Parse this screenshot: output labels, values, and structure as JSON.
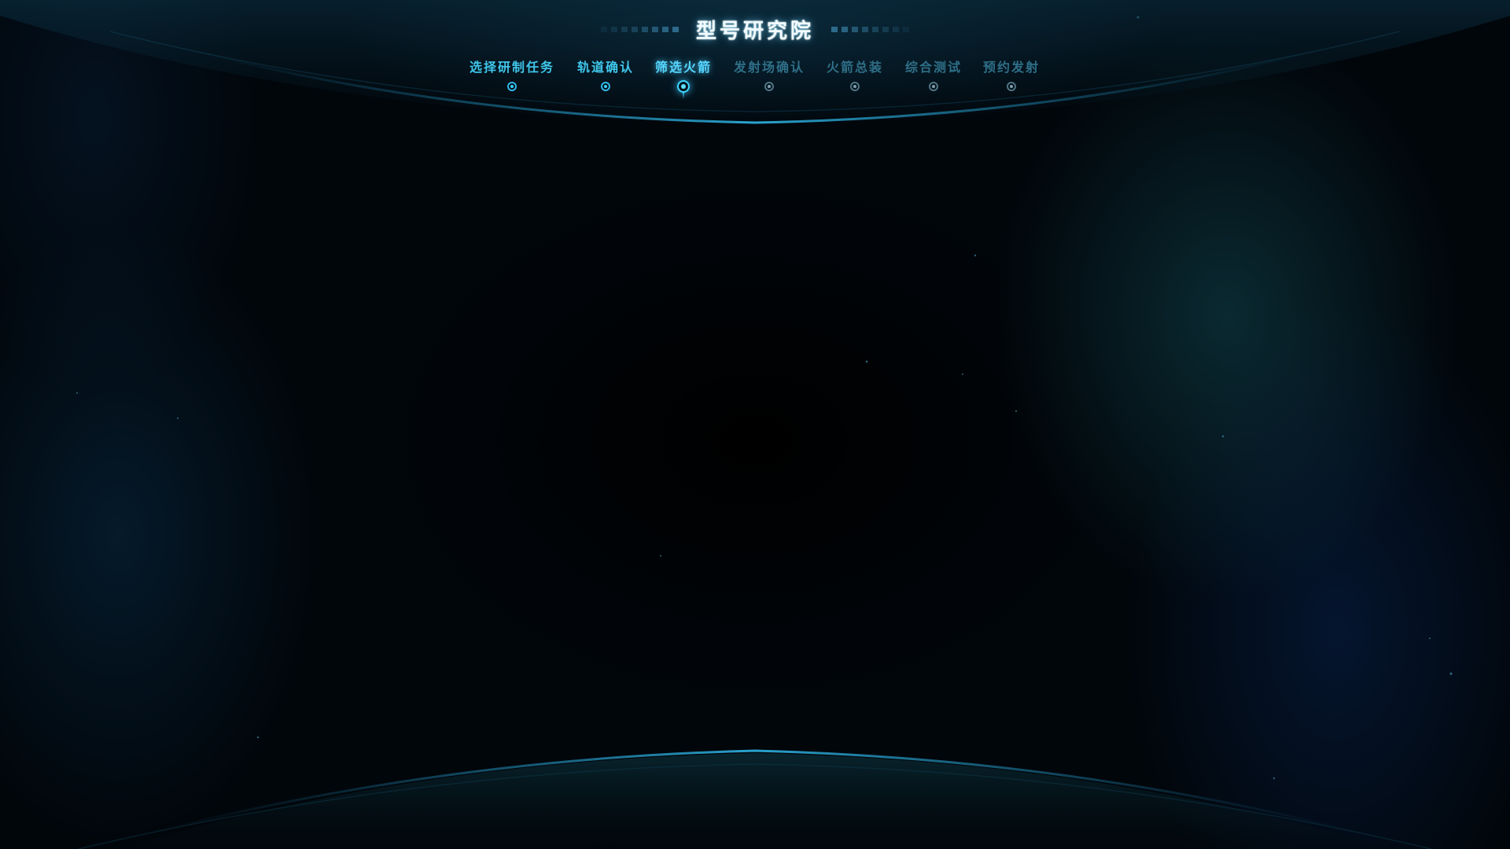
{
  "header": {
    "title": "型号研究院"
  },
  "steps": [
    {
      "label": "选择研制任务",
      "state": "done"
    },
    {
      "label": "轨道确认",
      "state": "done"
    },
    {
      "label": "筛选火箭",
      "state": "current"
    },
    {
      "label": "发射场确认",
      "state": "pending"
    },
    {
      "label": "火箭总装",
      "state": "pending"
    },
    {
      "label": "综合测试",
      "state": "pending"
    },
    {
      "label": "预约发射",
      "state": "pending"
    }
  ],
  "colors": {
    "accent": "#3fc6ea",
    "active": "#56d6ff",
    "pending": "#2f6f88",
    "background": "#010409"
  }
}
